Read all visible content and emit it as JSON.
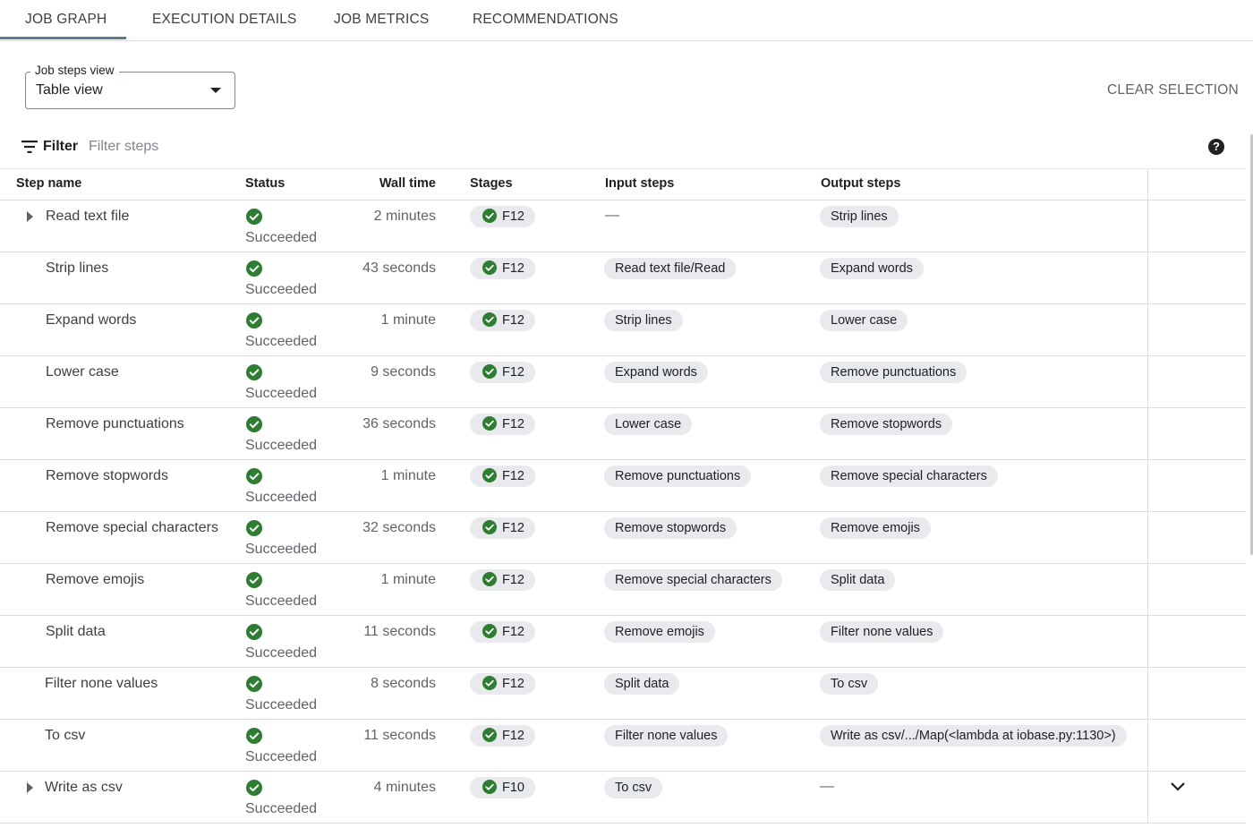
{
  "tabs": [
    "JOB GRAPH",
    "EXECUTION DETAILS",
    "JOB METRICS",
    "RECOMMENDATIONS"
  ],
  "steps_view": {
    "legend": "Job steps view",
    "value": "Table view"
  },
  "clear_selection": "CLEAR SELECTION",
  "filter": {
    "label": "Filter",
    "placeholder": "Filter steps"
  },
  "help_glyph": "?",
  "icons": {
    "filter": "filter-list-icon",
    "help": "help-icon",
    "status": "check-circle-icon",
    "expand": "triangle-right-icon",
    "collapse": "chevron-down-icon"
  },
  "colors": {
    "success": "#2e7d32",
    "chip_bg": "#e8eaed",
    "tab_active_underline": "#5f7a8a"
  },
  "table": {
    "columns": [
      "Step name",
      "Status",
      "Wall time",
      "Stages",
      "Input steps",
      "Output steps"
    ],
    "rows": [
      {
        "name": "Read text file",
        "expandable": true,
        "status": "Succeeded",
        "wall": "2 minutes",
        "stage": "F12",
        "input": "",
        "input_dash": "—",
        "output": "Strip lines"
      },
      {
        "name": "Strip lines",
        "expandable": false,
        "status": "Succeeded",
        "wall": "43 seconds",
        "stage": "F12",
        "input": "Read text file/Read",
        "output": "Expand words"
      },
      {
        "name": "Expand words",
        "expandable": false,
        "status": "Succeeded",
        "wall": "1 minute",
        "stage": "F12",
        "input": "Strip lines",
        "output": "Lower case"
      },
      {
        "name": "Lower case",
        "expandable": false,
        "status": "Succeeded",
        "wall": "9 seconds",
        "stage": "F12",
        "input": "Expand words",
        "output": "Remove punctuations"
      },
      {
        "name": "Remove punctuations",
        "expandable": false,
        "status": "Succeeded",
        "wall": "36 seconds",
        "stage": "F12",
        "input": "Lower case",
        "output": "Remove stopwords"
      },
      {
        "name": "Remove stopwords",
        "expandable": false,
        "status": "Succeeded",
        "wall": "1 minute",
        "stage": "F12",
        "input": "Remove punctuations",
        "output": "Remove special characters"
      },
      {
        "name": "Remove special characters",
        "expandable": false,
        "status": "Succeeded",
        "wall": "32 seconds",
        "stage": "F12",
        "input": "Remove stopwords",
        "output": "Remove emojis"
      },
      {
        "name": "Remove emojis",
        "expandable": false,
        "status": "Succeeded",
        "wall": "1 minute",
        "stage": "F12",
        "input": "Remove special characters",
        "output": "Split data"
      },
      {
        "name": "Split data",
        "expandable": false,
        "status": "Succeeded",
        "wall": "11 seconds",
        "stage": "F12",
        "input": "Remove emojis",
        "output": "Filter none values"
      },
      {
        "name": "Filter none values",
        "expandable": false,
        "status": "Succeeded",
        "wall": "8 seconds",
        "stage": "F12",
        "input": "Split data",
        "output": "To csv"
      },
      {
        "name": "To csv",
        "expandable": false,
        "status": "Succeeded",
        "wall": "11 seconds",
        "stage": "F12",
        "input": "Filter none values",
        "output": "Write as csv/.../Map(<lambda at iobase.py:1130>)"
      },
      {
        "name": "Write as csv",
        "expandable": true,
        "status": "Succeeded",
        "wall": "4 minutes",
        "stage": "F10",
        "input": "To csv",
        "output": "",
        "output_dash": "—"
      }
    ]
  }
}
